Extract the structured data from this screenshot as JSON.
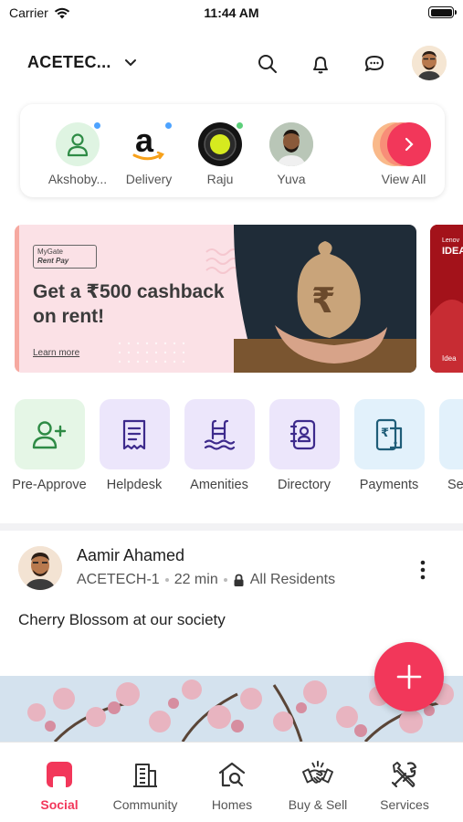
{
  "status_bar": {
    "carrier": "Carrier",
    "time": "11:44 AM"
  },
  "header": {
    "society_name": "ACETEC..."
  },
  "visitors": [
    {
      "label": "Akshoby...",
      "icon": "person-icon",
      "dot_color": "#4da3ff"
    },
    {
      "label": "Delivery",
      "icon": "amazon-logo",
      "dot_color": "#4da3ff"
    },
    {
      "label": "Raju",
      "icon": "raju-avatar",
      "dot_color": "#5ccf7a"
    },
    {
      "label": "Yuva",
      "icon": "yuva-avatar",
      "dot_color": "#5ccf7a"
    },
    {
      "label": "View All",
      "icon": "chevron-right-icon"
    }
  ],
  "banner": {
    "logo_line1": "MyGate",
    "logo_line2": "Rent Pay",
    "title": "Get a ₹500 cashback on rent!",
    "link": "Learn more",
    "next_text_1": "Lenov",
    "next_text_2": "IDEA",
    "next_text_3": "Idea"
  },
  "quick_actions": [
    {
      "label": "Pre-Approve",
      "icon": "add-user-icon",
      "bg": "#e5f6e6"
    },
    {
      "label": "Helpdesk",
      "icon": "receipt-icon",
      "bg": "#ece6fb"
    },
    {
      "label": "Amenities",
      "icon": "pool-icon",
      "bg": "#ece6fb"
    },
    {
      "label": "Directory",
      "icon": "contact-book-icon",
      "bg": "#ece6fb"
    },
    {
      "label": "Payments",
      "icon": "rupee-phone-icon",
      "bg": "#e2f1fb"
    },
    {
      "label": "Se",
      "icon": "settings-icon",
      "bg": "#e2f1fb"
    }
  ],
  "post": {
    "author": "Aamir Ahamed",
    "society": "ACETECH-1",
    "time": "22 min",
    "visibility": "All Residents",
    "text": "Cherry Blossom at our society"
  },
  "bottom_nav": [
    {
      "label": "Social",
      "icon": "social-icon",
      "active": true
    },
    {
      "label": "Community",
      "icon": "building-icon",
      "active": false
    },
    {
      "label": "Homes",
      "icon": "home-search-icon",
      "active": false
    },
    {
      "label": "Buy & Sell",
      "icon": "handshake-icon",
      "active": false
    },
    {
      "label": "Services",
      "icon": "tools-icon",
      "active": false
    }
  ],
  "colors": {
    "accent": "#f2375a",
    "green_dot": "#5ccf7a",
    "blue_dot": "#4da3ff"
  }
}
